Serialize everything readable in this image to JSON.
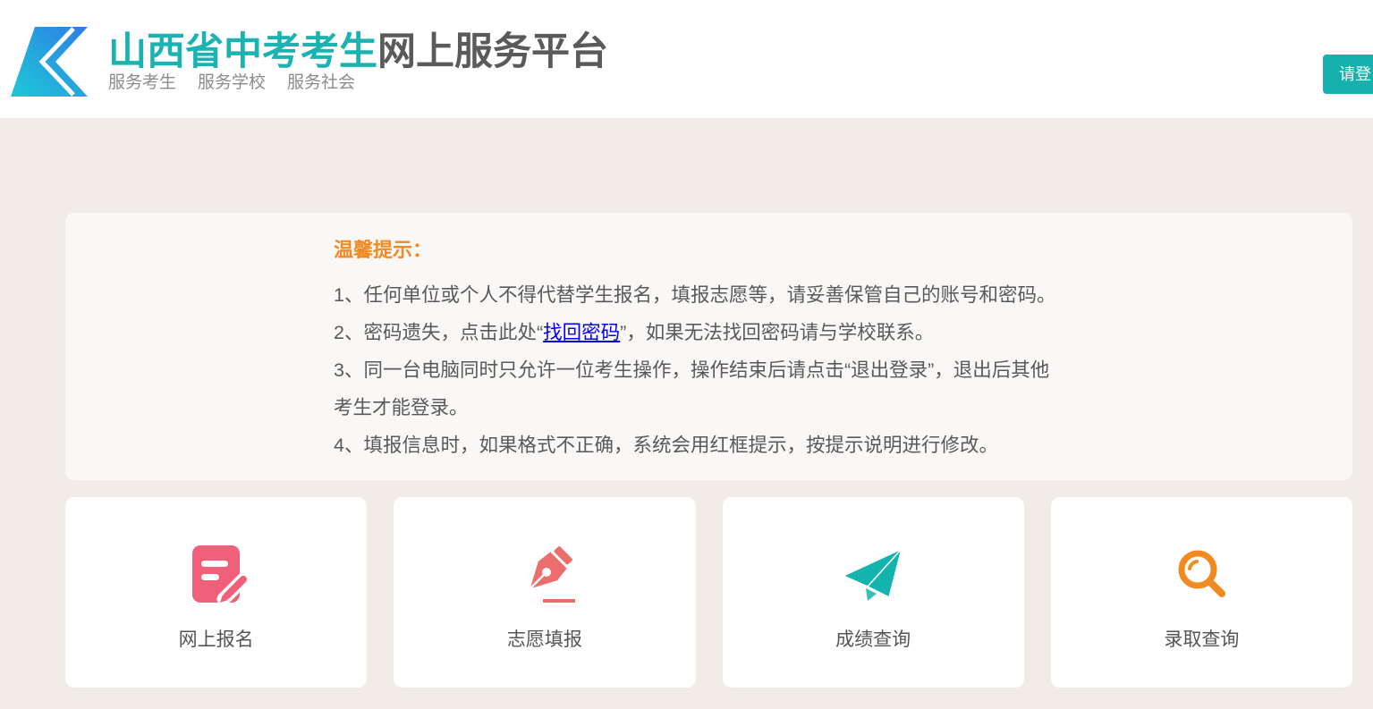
{
  "header": {
    "logo_icon": "chevron-logo-icon",
    "title_highlight": "山西省中考考生",
    "title_rest": "网上服务平台",
    "slogans": [
      "服务考生",
      "服务学校",
      "服务社会"
    ],
    "login_button": "请登"
  },
  "notice": {
    "title": "温馨提示：",
    "items": [
      "1、任何单位或个人不得代替学生报名，填报志愿等，请妥善保管自己的账号和密码。",
      {
        "before": "2、密码遗失，点击此处“",
        "link": "找回密码",
        "after": "”，如果无法找回密码请与学校联系。"
      },
      {
        "line1": "3、同一台电脑同时只允许一位考生操作，操作结束后请点击“退出登录”，退出后其他",
        "line2": "考生才能登录。"
      },
      "4、填报信息时，如果格式不正确，系统会用红框提示，按提示说明进行修改。"
    ]
  },
  "services": [
    {
      "label": "网上报名",
      "icon": "registration-form-icon",
      "color": "#f0607b"
    },
    {
      "label": "志愿填报",
      "icon": "pen-nib-icon",
      "color": "#ec6e6c"
    },
    {
      "label": "成绩查询",
      "icon": "paper-plane-icon",
      "color": "#13b3ae"
    },
    {
      "label": "录取查询",
      "icon": "magnifier-icon",
      "color": "#f28a22"
    }
  ],
  "colors": {
    "brand_teal": "#1ab3b1",
    "title_gray": "#5a5a5a",
    "login_button": "#17b1ad",
    "notice_title": "#f08a24",
    "link": "#0000ee",
    "page_background": "#f1ece7",
    "notice_background": "#faf8f6"
  }
}
